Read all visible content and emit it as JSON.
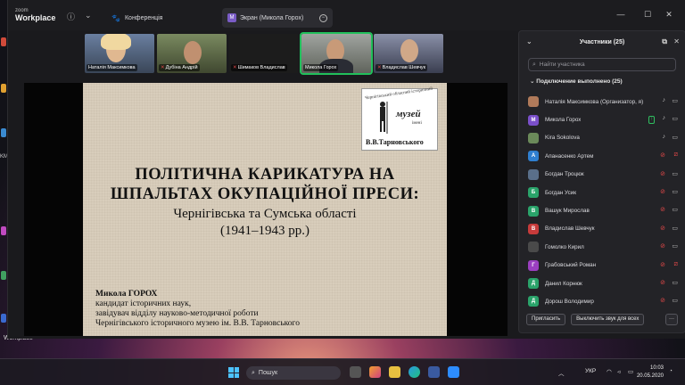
{
  "app": {
    "brand_top": "zoom",
    "brand_bottom": "Workplace"
  },
  "tabs": [
    {
      "label": "Конференція"
    },
    {
      "badge": "M",
      "label": "Экран (Микола Горох)"
    }
  ],
  "videos": [
    {
      "name": "Наталія Максимкова",
      "muted": false
    },
    {
      "name": "Дубіна Андрій",
      "muted": true
    },
    {
      "name": "Шимаков Владислав",
      "muted": true
    },
    {
      "name": "Микола Горох",
      "muted": false,
      "active": true
    },
    {
      "name": "Владислав Шевчук",
      "muted": true
    }
  ],
  "slide": {
    "logo_arc": "Чернігівський обласний історичний",
    "logo_muzei": "музей",
    "logo_imeni": "імені",
    "logo_name": "В.В.Тарновського",
    "title_line1": "ПОЛІТИЧНА КАРИКАТУРА НА",
    "title_line2": "ШПАЛЬТАХ ОКУПАЦІЙНОЇ ПРЕСИ:",
    "subtitle_line1": "Чернігівська та Сумська області",
    "subtitle_line2": "(1941–1943 рр.)",
    "author_name": "Микола ГОРОХ",
    "author_line1": "кандидат історичних наук,",
    "author_line2": "завідувач відділу науково-методичної роботи",
    "author_line3": "Чернігівського історичного музею ім. В.В. Тарновського"
  },
  "panel": {
    "title": "Участники (25)",
    "search_placeholder": "Найти участника",
    "group_title": "Подключение выполнено (25)",
    "participants": [
      {
        "initial": "",
        "name": "Наталія Максимкова (Организатор, я)",
        "color": "#b07a5a",
        "mic": "on",
        "cam": "on"
      },
      {
        "initial": "М",
        "name": "Микола Горох",
        "color": "#7a4fc9",
        "mic": "on",
        "cam": "on",
        "sharing": true
      },
      {
        "initial": "",
        "name": "Kira Sokolova",
        "color": "#6b8a5a",
        "mic": "on",
        "cam": "on"
      },
      {
        "initial": "А",
        "name": "Апанасенко Артем",
        "color": "#2f7fd0",
        "mic": "muted",
        "cam": "muted"
      },
      {
        "initial": "",
        "name": "Богдан Троцюк",
        "color": "#5a6f8a",
        "mic": "muted",
        "cam": "on"
      },
      {
        "initial": "Б",
        "name": "Богдан Усик",
        "color": "#2aa36a",
        "mic": "muted",
        "cam": "on"
      },
      {
        "initial": "В",
        "name": "Вашук Мирослав",
        "color": "#2aa36a",
        "mic": "muted",
        "cam": "on"
      },
      {
        "initial": "В",
        "name": "Владислав Шевчук",
        "color": "#c73b3b",
        "mic": "muted",
        "cam": "on"
      },
      {
        "initial": "",
        "name": "Гомолко Кирил",
        "color": "#4a4a4a",
        "mic": "muted",
        "cam": "on"
      },
      {
        "initial": "Г",
        "name": "Грабовський Роман",
        "color": "#9b3fc0",
        "mic": "muted",
        "cam": "muted"
      },
      {
        "initial": "Д",
        "name": "Данил Корнюк",
        "color": "#2aa36a",
        "mic": "muted",
        "cam": "on"
      },
      {
        "initial": "Д",
        "name": "Дорош Володимир",
        "color": "#2aa36a",
        "mic": "muted",
        "cam": "on"
      }
    ],
    "invite_label": "Пригласить",
    "mute_all_label": "Выключить звук для всех",
    "more_label": "···"
  },
  "desktop": {
    "workplace_label": "Workplace",
    "km_label": "KM"
  },
  "taskbar": {
    "search_label": "Пошук",
    "lang": "УКР",
    "time": "10:03",
    "date": "20.05.2020"
  }
}
